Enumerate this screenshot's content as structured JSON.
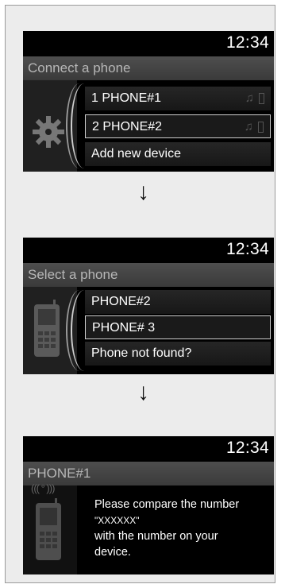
{
  "screen1": {
    "clock": "12:34",
    "title": "Connect a phone",
    "items": [
      {
        "label": "1 PHONE#1",
        "icons": [
          "music-note-icon",
          "battery-icon"
        ],
        "selected": false
      },
      {
        "label": "2 PHONE#2",
        "icons": [
          "music-note-icon",
          "battery-icon"
        ],
        "selected": true
      },
      {
        "label": "Add new device",
        "icons": [],
        "selected": false
      }
    ],
    "left_icon": "gear-icon"
  },
  "screen2": {
    "clock": "12:34",
    "title": "Select a phone",
    "items": [
      {
        "label": "PHONE#2",
        "selected": false
      },
      {
        "label": "PHONE# 3",
        "selected": true
      },
      {
        "label": "Phone not found?",
        "selected": false
      }
    ],
    "left_icon": "mobile-phone-icon"
  },
  "screen3": {
    "clock": "12:34",
    "title": "PHONE#1",
    "message_lines": [
      "Please compare the number",
      "\"XXXXXX\"",
      "with the number on your",
      "device."
    ],
    "left_icon": "mobile-phone-signal-icon"
  },
  "arrows": [
    "↓",
    "↓"
  ],
  "colors": {
    "screen_bg": "#000000",
    "title_bar": "#454545",
    "title_text": "#b7b7b7",
    "text": "#ffffff",
    "panel_bg": "#ececec"
  }
}
